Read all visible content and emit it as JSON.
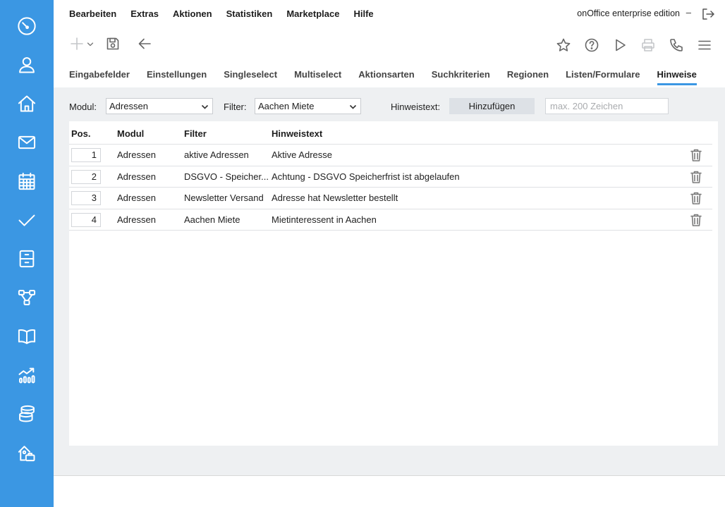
{
  "sidebar": {
    "icons": [
      "dashboard-icon",
      "user-icon",
      "home-icon",
      "mail-icon",
      "calendar-icon",
      "check-icon",
      "filing-cabinet-icon",
      "workflow-icon",
      "book-icon",
      "statistics-icon",
      "database-icon",
      "property-icon"
    ],
    "color": "#3b97e3"
  },
  "menu": {
    "items": [
      "Bearbeiten",
      "Extras",
      "Aktionen",
      "Statistiken",
      "Marketplace",
      "Hilfe"
    ],
    "edition": "onOffice enterprise edition",
    "minimize": "–"
  },
  "tabs": {
    "items": [
      "Eingabefelder",
      "Einstellungen",
      "Singleselect",
      "Multiselect",
      "Aktionsarten",
      "Suchkriterien",
      "Regionen",
      "Listen/Formulare",
      "Hinweise"
    ],
    "active": "Hinweise"
  },
  "filters": {
    "modul_label": "Modul:",
    "modul_value": "Adressen",
    "filter_label": "Filter:",
    "filter_value": "Aachen Miete",
    "hinweistext_label": "Hinweistext:",
    "add_button": "Hinzufügen",
    "text_placeholder": "max. 200 Zeichen"
  },
  "table": {
    "headers": [
      "Pos.",
      "Modul",
      "Filter",
      "Hinweistext"
    ],
    "rows": [
      {
        "pos": "1",
        "modul": "Adressen",
        "filter": "aktive Adressen",
        "text": "Aktive Adresse"
      },
      {
        "pos": "2",
        "modul": "Adressen",
        "filter": "DSGVO - Speicher...",
        "text": "Achtung - DSGVO Speicherfrist ist abgelaufen"
      },
      {
        "pos": "3",
        "modul": "Adressen",
        "filter": "Newsletter Versand",
        "text": "Adresse hat Newsletter bestellt"
      },
      {
        "pos": "4",
        "modul": "Adressen",
        "filter": "Aachen Miete",
        "text": "Mietinteressent in Aachen"
      }
    ]
  }
}
